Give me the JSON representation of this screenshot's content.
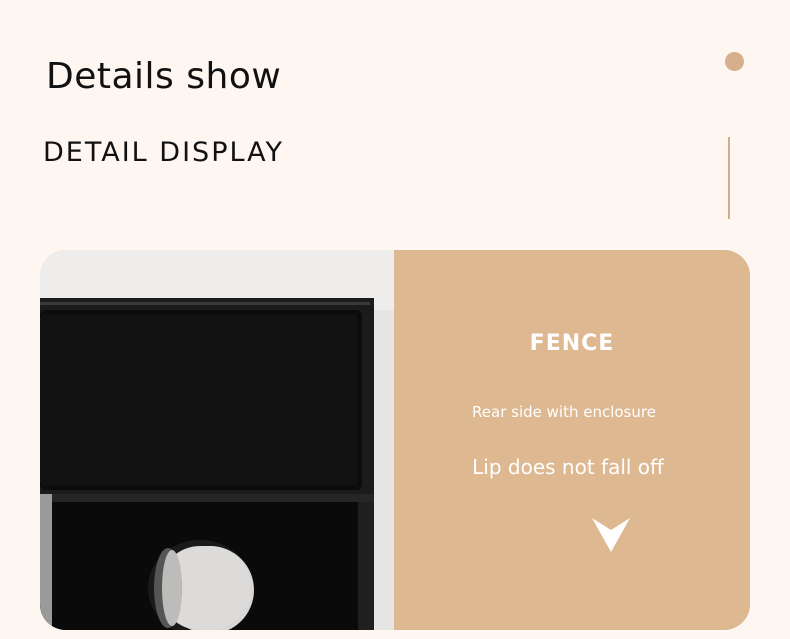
{
  "header": {
    "title": "Details show",
    "subtitle": "DETAIL DISPLAY"
  },
  "feature": {
    "heading": "FENCE",
    "line1": "Rear side with enclosure",
    "line2": "Lip does not fall off",
    "arrow_icon": "chevron-down-icon"
  },
  "colors": {
    "background": "#fdf6f1",
    "accent": "#d6b08c",
    "panel": "#ddb891",
    "text_dark": "#111111",
    "text_light": "#ffffff"
  }
}
